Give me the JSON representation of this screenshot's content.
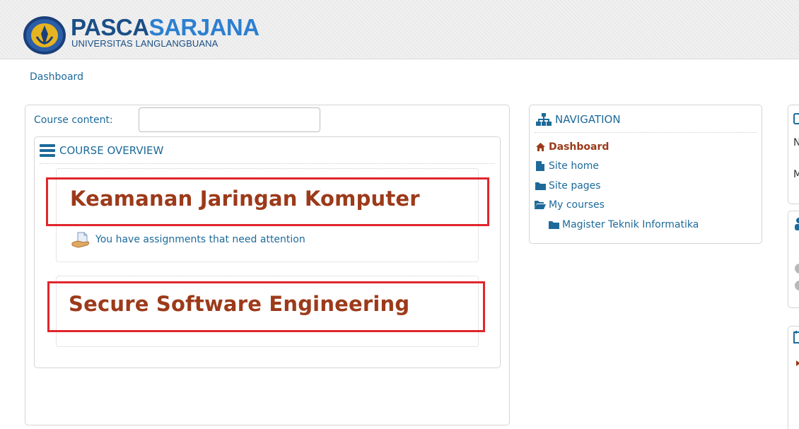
{
  "header": {
    "logo_title_part1": "PASCA",
    "logo_title_part2": "SARJANA",
    "logo_subtitle": "UNIVERSITAS LANGLANGBUANA"
  },
  "breadcrumb": {
    "label": "Dashboard"
  },
  "main": {
    "course_content_label": "Course content:",
    "course_content_value": "",
    "course_overview_title": "COURSE OVERVIEW",
    "courses": [
      {
        "name": "Keamanan Jaringan Komputer",
        "notice": "You have assignments that need attention"
      },
      {
        "name": "Secure Software Engineering"
      }
    ]
  },
  "navigation": {
    "title": "NAVIGATION",
    "items": [
      {
        "label": "Dashboard",
        "icon": "home-icon",
        "active": true
      },
      {
        "label": "Site home",
        "icon": "page-icon"
      },
      {
        "label": "Site pages",
        "icon": "folder-icon"
      },
      {
        "label": "My courses",
        "icon": "folder-open-icon"
      },
      {
        "label": "Magister Teknik Informatika",
        "icon": "folder-icon"
      }
    ]
  },
  "right_column": {
    "partial_text_1": "N",
    "partial_text_2": "M"
  },
  "colors": {
    "link": "#1d6a9a",
    "course_title": "#9c3a1a",
    "highlight": "#e0262c",
    "brand_dark": "#1a4f86",
    "brand_light": "#2d7fd0"
  }
}
